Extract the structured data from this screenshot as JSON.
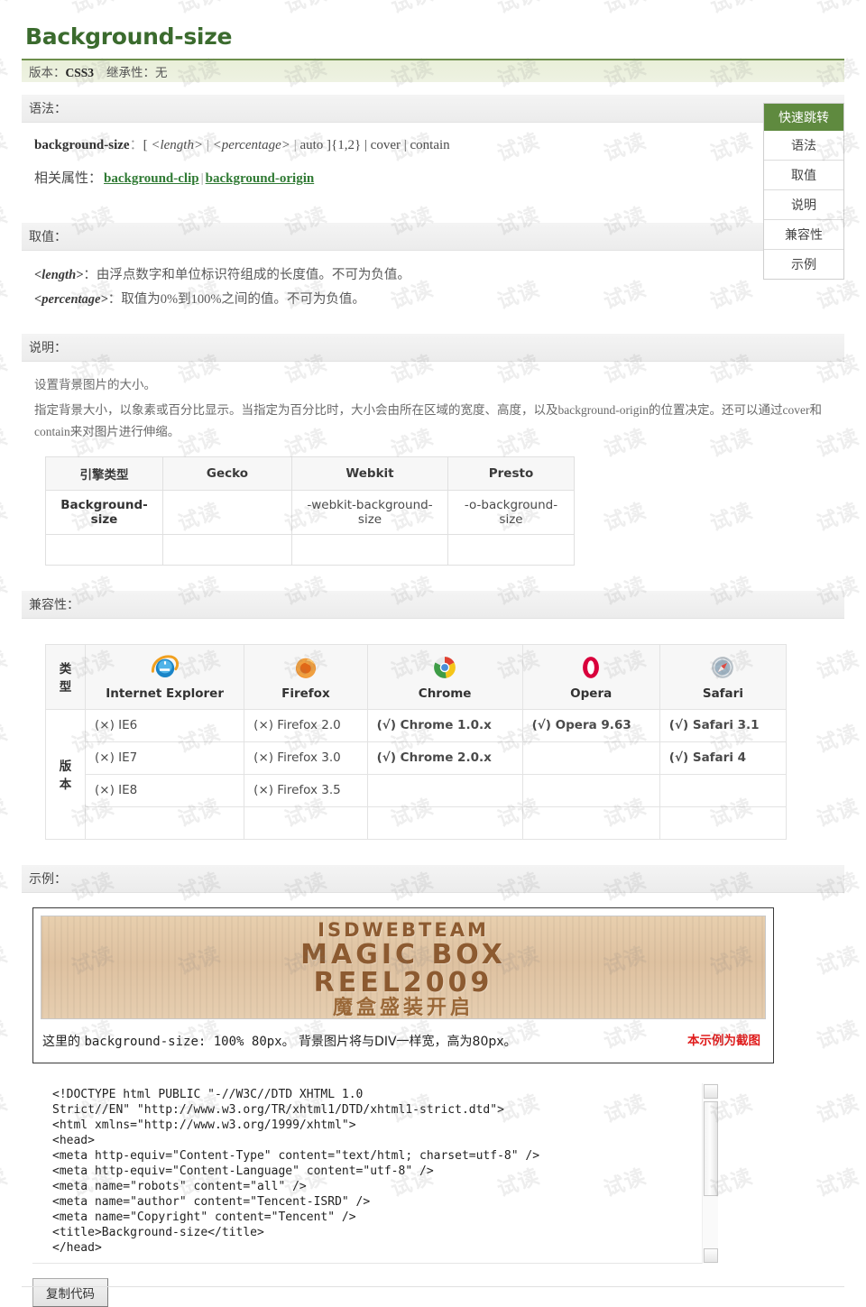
{
  "title": "Background-size",
  "meta": {
    "version_label": "版本：",
    "version_value": "CSS3",
    "inherit_label": "继承性：",
    "inherit_value": "无"
  },
  "sections": {
    "syntax_heading": "语法：",
    "values_heading": "取值：",
    "description_heading": "说明：",
    "compat_heading": "兼容性：",
    "example_heading": "示例："
  },
  "syntax": {
    "property": "background-size",
    "colon": "：",
    "definition_open": "[ ",
    "length_token": "<length>",
    "pipe1": " | ",
    "percentage_token": "<percentage>",
    "pipe2": " | ",
    "auto_token": "auto",
    "definition_close": " ]{1,2} | cover | contain",
    "related_label": "相关属性：",
    "related": [
      {
        "label": "background-clip"
      },
      {
        "label": "background-origin"
      }
    ],
    "related_sep": "|"
  },
  "values": [
    {
      "token": "<length>",
      "sep": "：",
      "text": "由浮点数字和单位标识符组成的长度值。不可为负值。"
    },
    {
      "token": "<percentage>",
      "sep": "：",
      "text": "取值为0%到100%之间的值。不可为负值。"
    }
  ],
  "description": {
    "line1": "设置背景图片的大小。",
    "line2": "指定背景大小，以象素或百分比显示。当指定为百分比时，大小会由所在区域的宽度、高度，以及background-origin的位置决定。还可以通过cover和contain来对图片进行伸缩。"
  },
  "engine_table": {
    "headers": [
      "引擎类型",
      "Gecko",
      "Webkit",
      "Presto"
    ],
    "rows": [
      [
        "Background-size",
        "",
        "-webkit-background-size",
        "-o-background-size"
      ],
      [
        "",
        "",
        "",
        ""
      ]
    ]
  },
  "compat_table": {
    "corner_label": "类型",
    "side_label": "版本",
    "browsers": [
      {
        "name": "Internet Explorer",
        "icon": "internet-explorer-icon"
      },
      {
        "name": "Firefox",
        "icon": "firefox-icon"
      },
      {
        "name": "Chrome",
        "icon": "chrome-icon"
      },
      {
        "name": "Opera",
        "icon": "opera-icon"
      },
      {
        "name": "Safari",
        "icon": "safari-icon"
      }
    ],
    "rows": [
      [
        {
          "text": "(×) IE6",
          "supported": false
        },
        {
          "text": "(×) Firefox 2.0",
          "supported": false
        },
        {
          "text": "(√) Chrome 1.0.x",
          "supported": true
        },
        {
          "text": "(√) Opera 9.63",
          "supported": true
        },
        {
          "text": "(√) Safari 3.1",
          "supported": true
        }
      ],
      [
        {
          "text": "(×) IE7",
          "supported": false
        },
        {
          "text": "(×) Firefox 3.0",
          "supported": false
        },
        {
          "text": "(√) Chrome 2.0.x",
          "supported": true
        },
        {
          "text": "",
          "supported": false
        },
        {
          "text": "(√) Safari 4",
          "supported": true
        }
      ],
      [
        {
          "text": "(×) IE8",
          "supported": false
        },
        {
          "text": "(×) Firefox 3.5",
          "supported": false
        },
        {
          "text": "",
          "supported": false
        },
        {
          "text": "",
          "supported": false
        },
        {
          "text": "",
          "supported": false
        }
      ],
      [
        {
          "text": "",
          "supported": false
        },
        {
          "text": "",
          "supported": false
        },
        {
          "text": "",
          "supported": false
        },
        {
          "text": "",
          "supported": false
        },
        {
          "text": "",
          "supported": false
        }
      ]
    ]
  },
  "quicknav": {
    "title": "快速跳转",
    "items": [
      {
        "label": "语法"
      },
      {
        "label": "取值"
      },
      {
        "label": "说明"
      },
      {
        "label": "兼容性"
      },
      {
        "label": "示例"
      }
    ],
    "accent_color": "#5f8a3f"
  },
  "example": {
    "banner": {
      "line1": "ISDWEBTEAM",
      "line2": "MAGIC BOX",
      "line3": "REEL2009",
      "line4": "魔盒盛装开启"
    },
    "caption_prefix": "这里的 ",
    "caption_code": "background-size: 100% 80px。",
    "caption_suffix": " 背景图片将与DIV一样宽，高为80px。",
    "note": "本示例为截图",
    "note_color": "#e01b1b"
  },
  "code": {
    "content": "<!DOCTYPE html PUBLIC \"-//W3C//DTD XHTML 1.0\nStrict//EN\" \"http://www.w3.org/TR/xhtml1/DTD/xhtml1-strict.dtd\">\n<html xmlns=\"http://www.w3.org/1999/xhtml\">\n<head>\n<meta http-equiv=\"Content-Type\" content=\"text/html; charset=utf-8\" />\n<meta http-equiv=\"Content-Language\" content=\"utf-8\" />\n<meta name=\"robots\" content=\"all\" />\n<meta name=\"author\" content=\"Tencent-ISRD\" />\n<meta name=\"Copyright\" content=\"Tencent\" />\n<title>Background-size</title>\n</head>",
    "copy_label": "复制代码"
  },
  "watermark": {
    "text": "试读"
  }
}
